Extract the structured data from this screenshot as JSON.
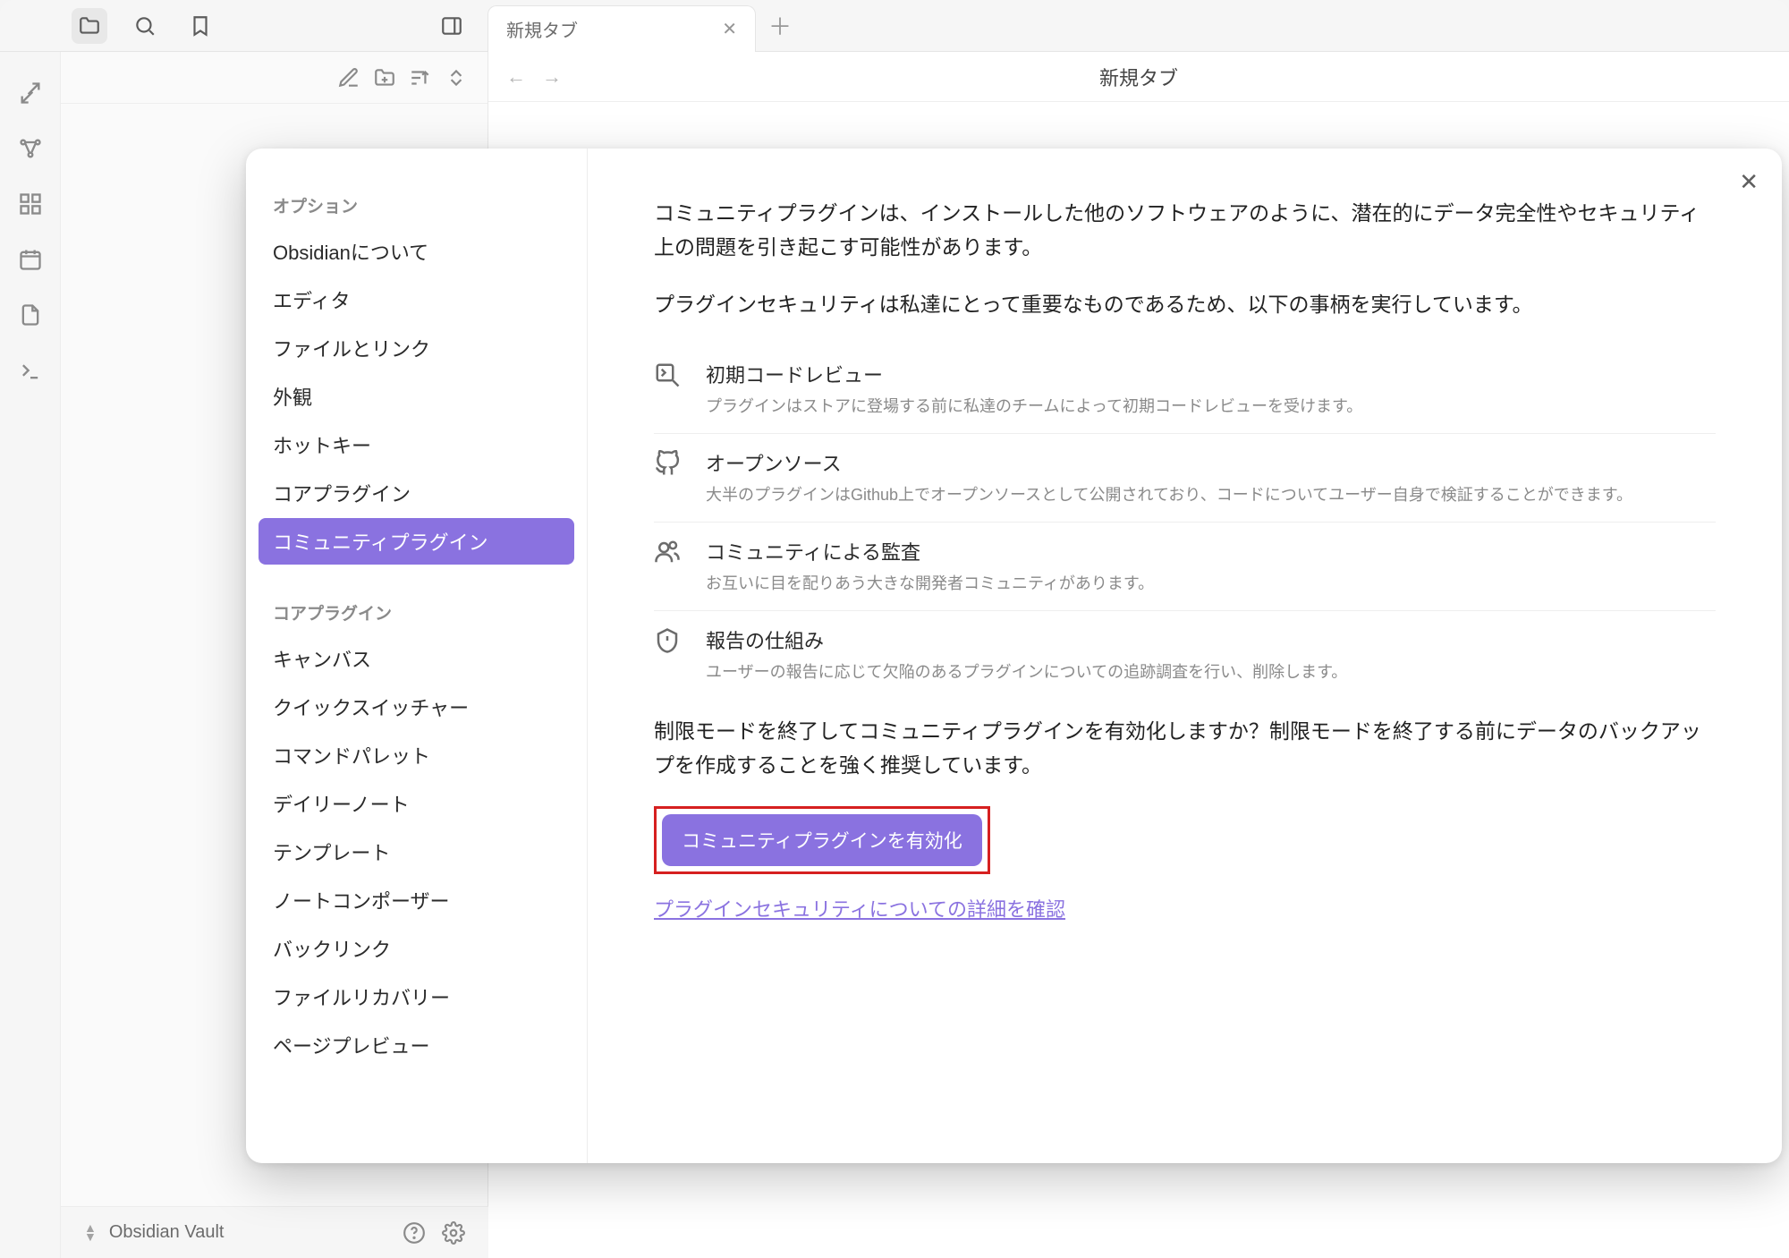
{
  "window": {
    "tab_title": "新規タブ",
    "page_title": "新規タブ"
  },
  "status": {
    "vault_name": "Obsidian Vault"
  },
  "settings": {
    "sidebar": {
      "options_header": "オプション",
      "about": "Obsidianについて",
      "editor": "エディタ",
      "files_links": "ファイルとリンク",
      "appearance": "外観",
      "hotkeys": "ホットキー",
      "core_plugins": "コアプラグイン",
      "community_plugins": "コミュニティプラグイン",
      "core_plugins_header": "コアプラグイン",
      "canvas": "キャンバス",
      "quick_switcher": "クイックスイッチャー",
      "command_palette": "コマンドパレット",
      "daily_notes": "デイリーノート",
      "templates": "テンプレート",
      "note_composer": "ノートコンポーザー",
      "backlinks": "バックリンク",
      "file_recovery": "ファイルリカバリー",
      "page_preview": "ページプレビュー"
    },
    "content": {
      "intro_paragraph": "コミュニティプラグインは、インストールした他のソフトウェアのように、潜在的にデータ完全性やセキュリティ上の問題を引き起こす可能性があります。",
      "security_paragraph": "プラグインセキュリティは私達にとって重要なものであるため、以下の事柄を実行しています。",
      "items": [
        {
          "title": "初期コードレビュー",
          "desc": "プラグインはストアに登場する前に私達のチームによって初期コードレビューを受けます。"
        },
        {
          "title": "オープンソース",
          "desc": "大半のプラグインはGithub上でオープンソースとして公開されており、コードについてユーザー自身で検証することができます。"
        },
        {
          "title": "コミュニティによる監査",
          "desc": "お互いに目を配りあう大きな開発者コミュニティがあります。"
        },
        {
          "title": "報告の仕組み",
          "desc": "ユーザーの報告に応じて欠陥のあるプラグインについての追跡調査を行い、削除します。"
        }
      ],
      "confirm_paragraph": "制限モードを終了してコミュニティプラグインを有効化しますか？制限モードを終了する前にデータのバックアップを作成することを強く推奨しています。",
      "enable_button": "コミュニティプラグインを有効化",
      "learn_more_link": "プラグインセキュリティについての詳細を確認"
    }
  },
  "icons": {
    "folder": "folder-icon",
    "search": "search-icon",
    "bookmark": "bookmark-icon",
    "panel": "panel-right-icon"
  }
}
